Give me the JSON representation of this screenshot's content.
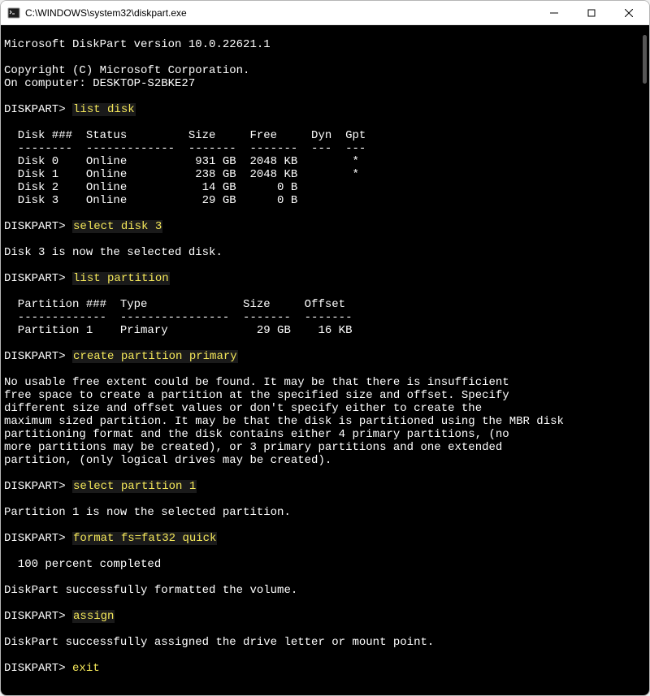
{
  "window": {
    "title": "C:\\WINDOWS\\system32\\diskpart.exe"
  },
  "header": {
    "version_line": "Microsoft DiskPart version 10.0.22621.1",
    "copyright": "Copyright (C) Microsoft Corporation.",
    "computer": "On computer: DESKTOP-S2BKE27"
  },
  "prompts": {
    "text": "DISKPART> "
  },
  "commands": {
    "list_disk": "list disk",
    "select_disk": "select disk 3",
    "list_partition": "list partition",
    "create_partition": "create partition primary",
    "select_partition": "select partition 1",
    "format": "format fs=fat32 quick",
    "assign": "assign",
    "exit": "exit"
  },
  "disk_table": {
    "header": "  Disk ###  Status         Size     Free     Dyn  Gpt",
    "divider": "  --------  -------------  -------  -------  ---  ---",
    "rows": [
      "  Disk 0    Online          931 GB  2048 KB        *",
      "  Disk 1    Online          238 GB  2048 KB        *",
      "  Disk 2    Online           14 GB      0 B",
      "  Disk 3    Online           29 GB      0 B"
    ]
  },
  "select_disk_msg": "Disk 3 is now the selected disk.",
  "partition_table": {
    "header": "  Partition ###  Type              Size     Offset",
    "divider": "  -------------  ----------------  -------  -------",
    "rows": [
      "  Partition 1    Primary             29 GB    16 KB"
    ]
  },
  "create_partition_error": [
    "No usable free extent could be found. It may be that there is insufficient",
    "free space to create a partition at the specified size and offset. Specify",
    "different size and offset values or don't specify either to create the",
    "maximum sized partition. It may be that the disk is partitioned using the MBR disk",
    "partitioning format and the disk contains either 4 primary partitions, (no",
    "more partitions may be created), or 3 primary partitions and one extended",
    "partition, (only logical drives may be created)."
  ],
  "select_partition_msg": "Partition 1 is now the selected partition.",
  "format_progress": "  100 percent completed",
  "format_success": "DiskPart successfully formatted the volume.",
  "assign_success": "DiskPart successfully assigned the drive letter or mount point."
}
